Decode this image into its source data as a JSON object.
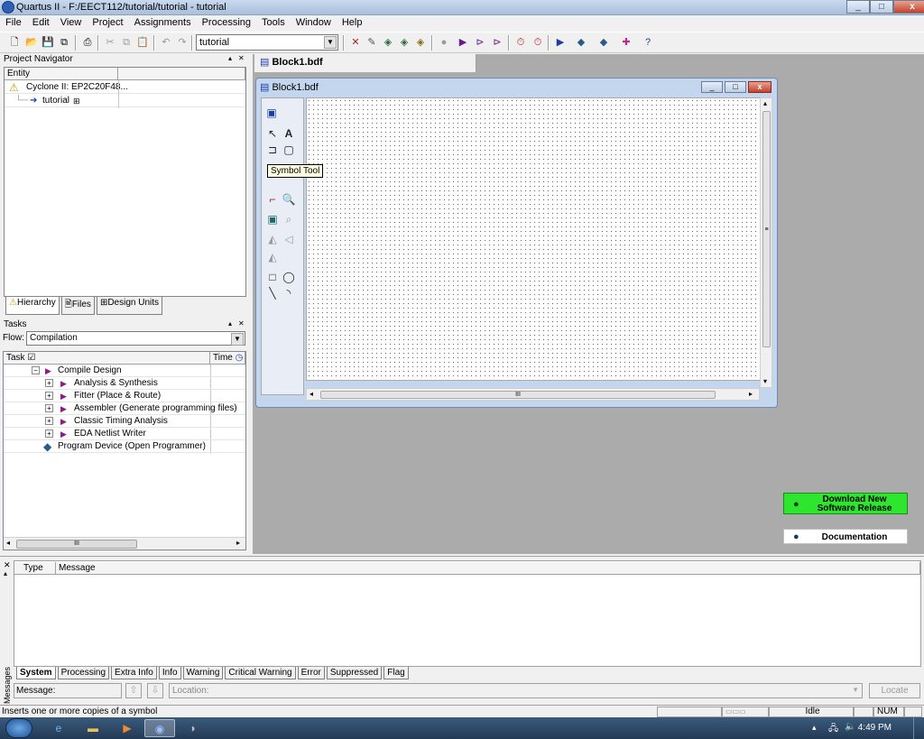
{
  "window": {
    "title": "Quartus II - F:/EECT112/tutorial/tutorial - tutorial",
    "min": "_",
    "max": "□",
    "close": "x"
  },
  "menu": [
    "File",
    "Edit",
    "View",
    "Project",
    "Assignments",
    "Processing",
    "Tools",
    "Window",
    "Help"
  ],
  "toolbar": {
    "project_combo": "tutorial"
  },
  "navigator": {
    "title": "Project Navigator",
    "column": "Entity",
    "device": "Cyclone II: EP2C20F48...",
    "top_entity": "tutorial",
    "tabs": [
      "Hierarchy",
      "Files",
      "Design Units"
    ]
  },
  "tasks": {
    "title": "Tasks",
    "flow_label": "Flow:",
    "flow_value": "Compilation",
    "col_task": "Task",
    "col_time": "Time",
    "items": [
      {
        "label": "Compile Design",
        "level": 0
      },
      {
        "label": "Analysis & Synthesis",
        "level": 1
      },
      {
        "label": "Fitter (Place & Route)",
        "level": 1
      },
      {
        "label": "Assembler (Generate programming files)",
        "level": 1
      },
      {
        "label": "Classic Timing Analysis",
        "level": 1
      },
      {
        "label": "EDA Netlist Writer",
        "level": 1
      },
      {
        "label": "Program Device (Open Programmer)",
        "level": 0
      }
    ],
    "scroll_grip": "III"
  },
  "document": {
    "tab": "Block1.bdf",
    "window_title": "Block1.bdf",
    "tooltip": "Symbol Tool",
    "scroll_grip": "III",
    "vscroll_grip": "≡"
  },
  "side_buttons": {
    "download": "Download New Software Release",
    "documentation": "Documentation"
  },
  "messages": {
    "side_label": "Messages",
    "col_type": "Type",
    "col_message": "Message",
    "tabs": [
      "System",
      "Processing",
      "Extra Info",
      "Info",
      "Warning",
      "Critical Warning",
      "Error",
      "Suppressed",
      "Flag"
    ],
    "message_label": "Message:",
    "location_placeholder": "Location:",
    "locate": "Locate"
  },
  "status": {
    "text": "Inserts one or more copies of a symbol",
    "state": "Idle",
    "num": "NUM"
  },
  "taskbar": {
    "time": "4:49 PM"
  },
  "colors": {
    "accent_green": "#2ee62e",
    "canvas_dot": "#6b6b6b"
  }
}
